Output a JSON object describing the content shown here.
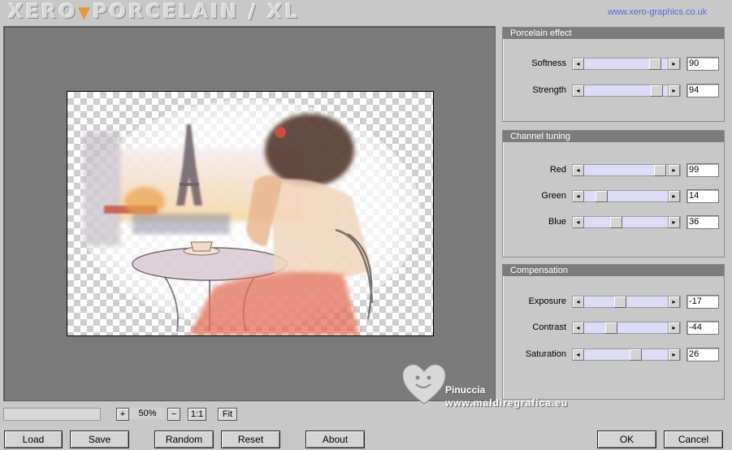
{
  "header": {
    "logo_part1": "XERO",
    "logo_part2": "PORCELAIN / XL",
    "site_link": "www.xero-graphics.co.uk"
  },
  "panels": [
    {
      "title": "Porcelain effect",
      "sliders": [
        {
          "label": "Softness",
          "value": "90"
        },
        {
          "label": "Strength",
          "value": "94"
        }
      ]
    },
    {
      "title": "Channel tuning",
      "sliders": [
        {
          "label": "Red",
          "value": "99"
        },
        {
          "label": "Green",
          "value": "14"
        },
        {
          "label": "Blue",
          "value": "36"
        }
      ]
    },
    {
      "title": "Compensation",
      "sliders": [
        {
          "label": "Exposure",
          "value": "-17"
        },
        {
          "label": "Contrast",
          "value": "-44"
        },
        {
          "label": "Saturation",
          "value": "26"
        }
      ]
    }
  ],
  "zoom": {
    "plus": "+",
    "minus": "−",
    "value": "50%",
    "one_to_one": "1:1",
    "fit": "Fit"
  },
  "watermark": {
    "name": "Pinuccia",
    "url": "www.maldiregrafica.eu"
  },
  "buttons": {
    "load": "Load",
    "save": "Save",
    "random": "Random",
    "reset": "Reset",
    "about": "About",
    "ok": "OK",
    "cancel": "Cancel"
  },
  "icons": {
    "slider_left": "◂",
    "slider_right": "▸",
    "logo_arrow": "▼"
  }
}
